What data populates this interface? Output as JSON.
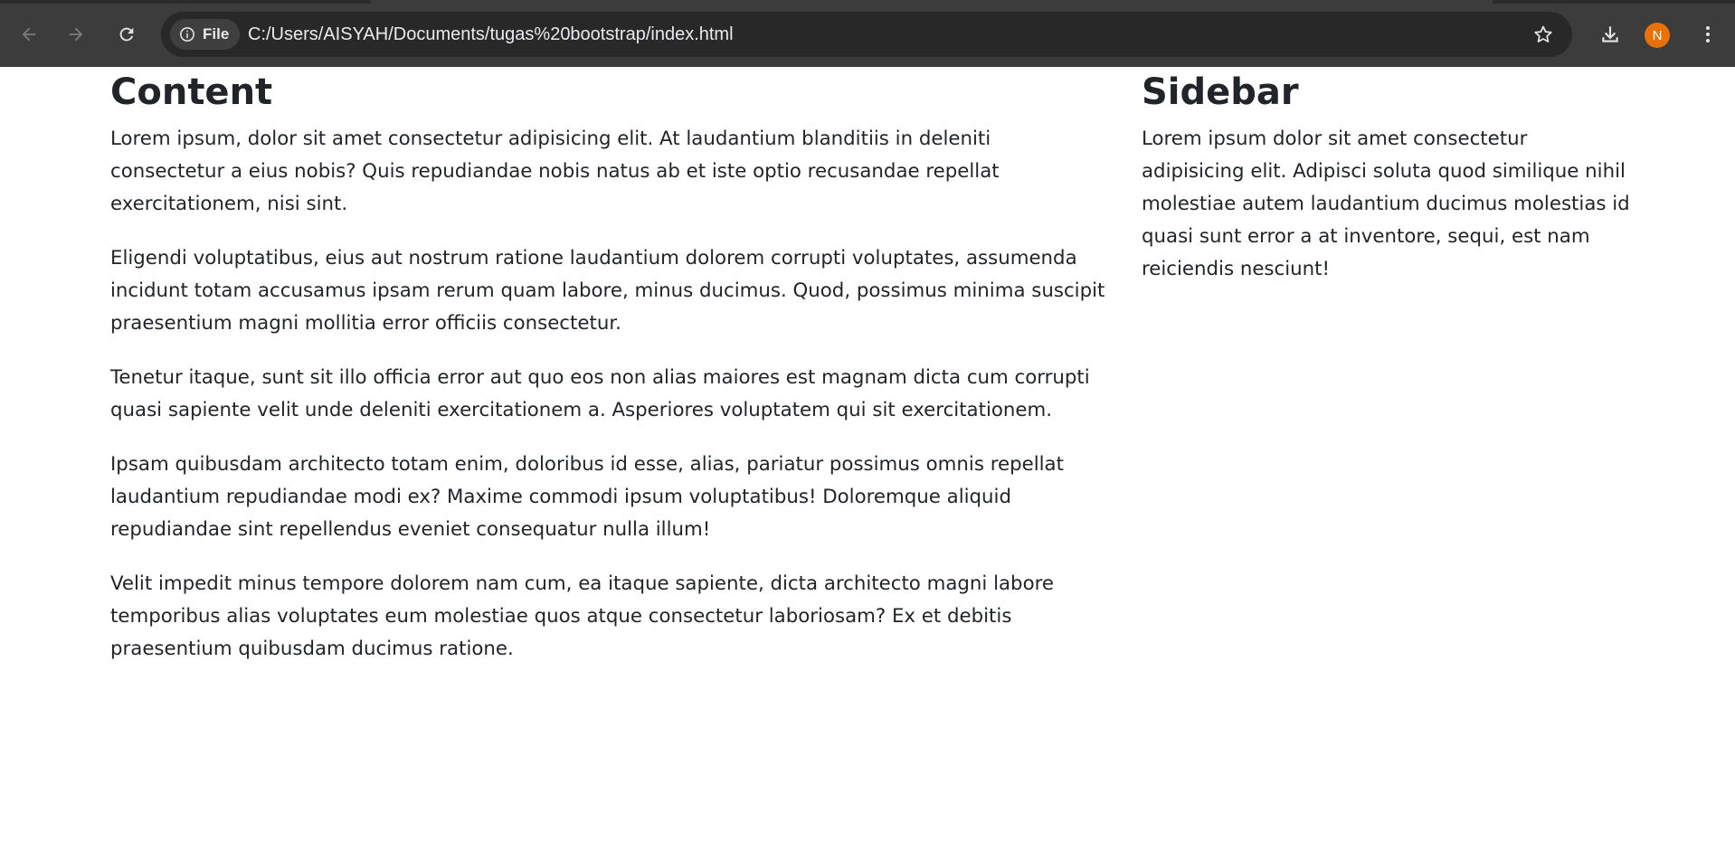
{
  "browser": {
    "site_chip_label": "File",
    "url": "C:/Users/AISYAH/Documents/tugas%20bootstrap/index.html",
    "profile_initial": "N",
    "icons": {
      "back": "arrow-left-icon",
      "forward": "arrow-right-icon",
      "reload": "reload-icon",
      "site_info": "info-icon",
      "bookmark": "star-icon",
      "download": "download-icon",
      "menu": "three-dots-vertical-icon"
    },
    "colors": {
      "toolbar": "#3c3c3c",
      "omnibox": "#282828",
      "avatar": "#e8710a"
    }
  },
  "content": {
    "heading": "Content",
    "paragraphs": [
      "Lorem ipsum, dolor sit amet consectetur adipisicing elit. At laudantium blanditiis in deleniti consectetur a eius nobis? Quis repudiandae nobis natus ab et iste optio recusandae repellat exercitationem, nisi sint.",
      "Eligendi voluptatibus, eius aut nostrum ratione laudantium dolorem corrupti voluptates, assumenda incidunt totam accusamus ipsam rerum quam labore, minus ducimus. Quod, possimus minima suscipit praesentium magni mollitia error officiis consectetur.",
      "Tenetur itaque, sunt sit illo officia error aut quo eos non alias maiores est magnam dicta cum corrupti quasi sapiente velit unde deleniti exercitationem a. Asperiores voluptatem qui sit exercitationem.",
      "Ipsam quibusdam architecto totam enim, doloribus id esse, alias, pariatur possimus omnis repellat laudantium repudiandae modi ex? Maxime commodi ipsum voluptatibus! Doloremque aliquid repudiandae sint repellendus eveniet consequatur nulla illum!",
      "Velit impedit minus tempore dolorem nam cum, ea itaque sapiente, dicta architecto magni labore temporibus alias voluptates eum molestiae quos atque consectetur laboriosam? Ex et debitis praesentium quibusdam ducimus ratione."
    ]
  },
  "sidebar": {
    "heading": "Sidebar",
    "paragraph": "Lorem ipsum dolor sit amet consectetur adipisicing elit. Adipisci soluta quod similique nihil molestiae autem laudantium ducimus molestias id quasi sunt error a at inventore, sequi, est nam reiciendis nesciunt!"
  }
}
